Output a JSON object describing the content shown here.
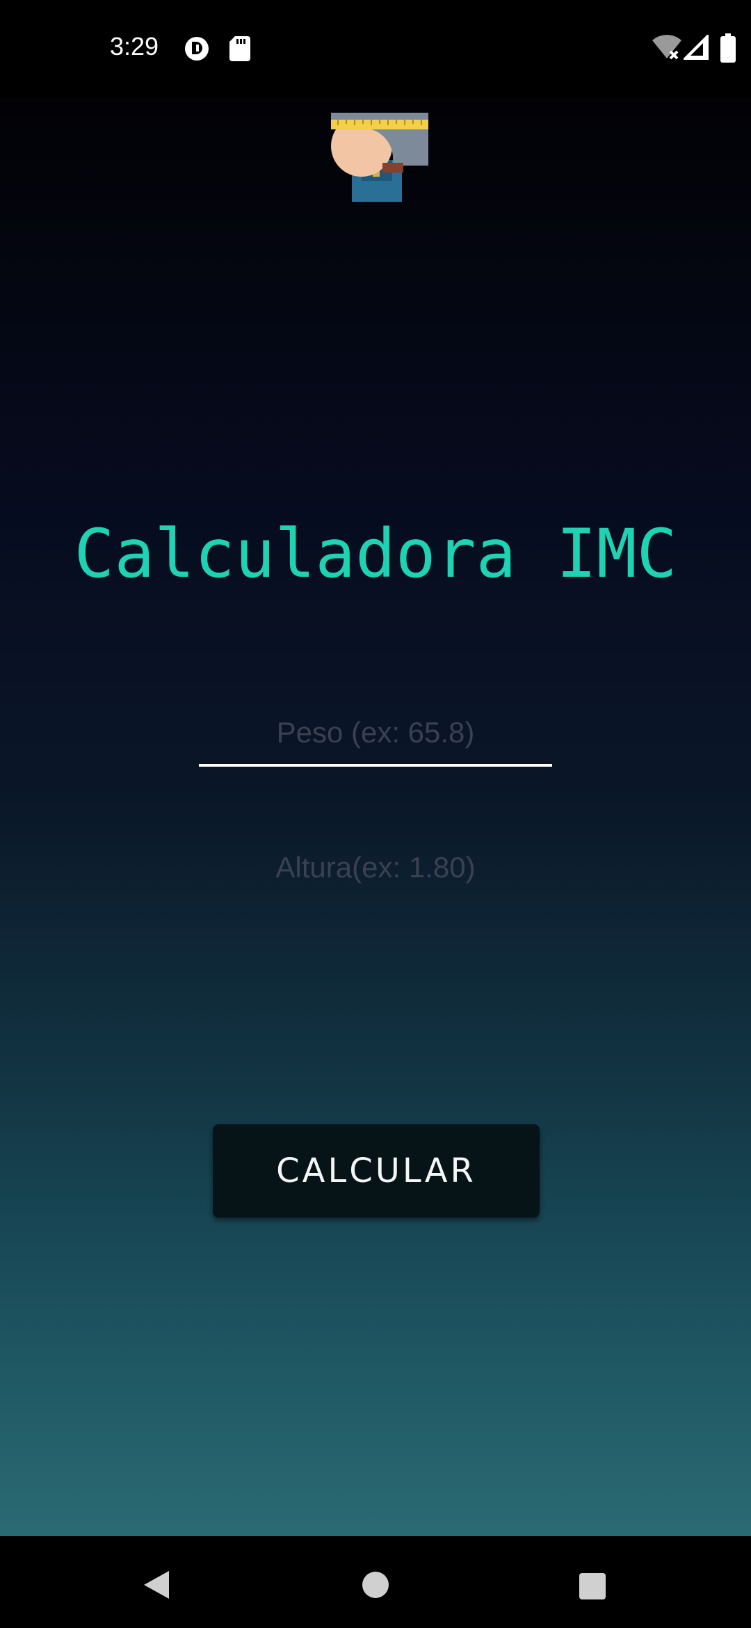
{
  "status_bar": {
    "time": "3:29",
    "icons": [
      "notification-circle-icon",
      "sd-card-icon",
      "wifi-off-icon",
      "signal-icon",
      "battery-icon"
    ]
  },
  "app": {
    "logo_icon": "person-measuring-tape-icon",
    "title": "Calculadora IMC",
    "title_color": "#1dd3b3",
    "weight_field": {
      "placeholder": "Peso (ex: 65.8)",
      "value": ""
    },
    "height_field": {
      "placeholder": "Altura(ex: 1.80)",
      "value": ""
    },
    "calculate_label": "CALCULAR"
  },
  "nav_bar": {
    "icons": [
      "back-icon",
      "home-icon",
      "recents-icon"
    ]
  }
}
